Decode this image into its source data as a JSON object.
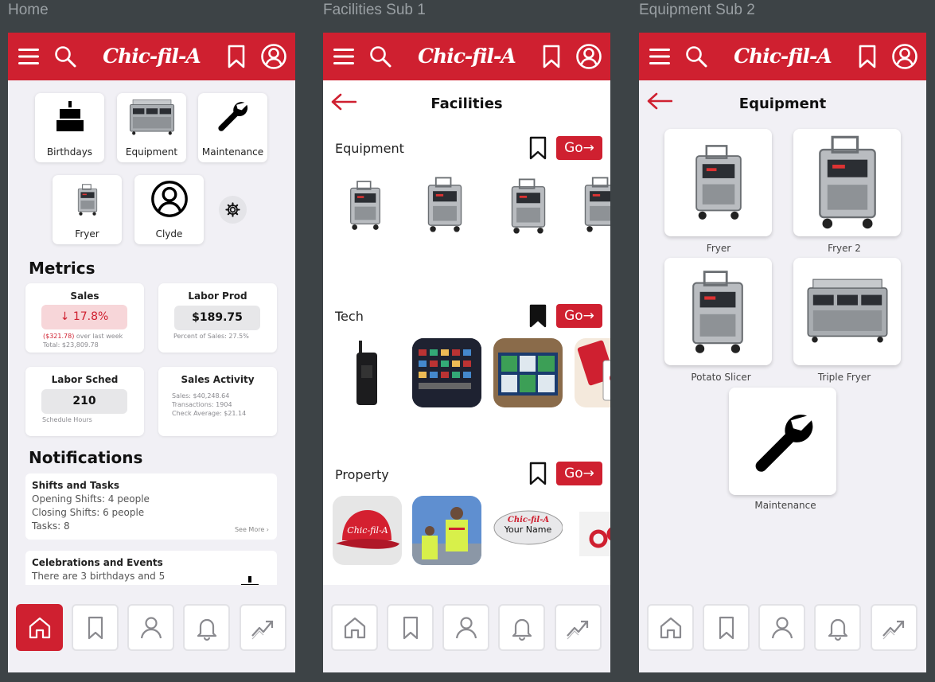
{
  "frames": {
    "home": "Home",
    "facilities": "Facilities Sub 1",
    "equipment": "Equipment Sub 2"
  },
  "brand": {
    "logo_text": "Chic-fil-A",
    "red": "#cf2030"
  },
  "icons": {
    "menu": "menu-icon",
    "search": "search-icon",
    "bookmark": "bookmark-icon",
    "profile": "profile-icon",
    "home": "home-icon",
    "bell": "bell-icon",
    "trend": "trending-icon",
    "gear": "gear-icon",
    "wrench": "wrench-icon",
    "cake": "cake-icon",
    "back": "back-arrow-icon"
  },
  "home": {
    "tiles": [
      "Birthdays",
      "Equipment",
      "Maintenance",
      "Fryer",
      "Clyde"
    ],
    "metrics_title": "Metrics",
    "sales": {
      "title": "Sales",
      "value": "17.8%",
      "change": "($321.78)",
      "change_suffix": " over last week",
      "total": "Total: $23,809.78"
    },
    "labor_prod": {
      "title": "Labor Prod",
      "value": "$189.75",
      "sub": "Percent of Sales: 27.5%"
    },
    "labor_sched": {
      "title": "Labor Sched",
      "value": "210",
      "sub": "Schedule Hours"
    },
    "sales_activity": {
      "title": "Sales Activity",
      "lines": [
        "Sales: $40,248.64",
        "Transactions: 1904",
        "Check Average: $21.14"
      ]
    },
    "notifications_title": "Notifications",
    "shifts": {
      "title": "Shifts and Tasks",
      "lines": [
        "Opening Shifts: 4 people",
        "Closing Shifts: 6 people",
        "Tasks: 8"
      ],
      "see_more": "See More ›"
    },
    "celebrations": {
      "title": "Celebrations and Events",
      "line": "There are 3 birthdays and 5"
    }
  },
  "facilities": {
    "title": "Facilities",
    "rows": [
      {
        "label": "Equipment",
        "go": "Go→",
        "bookmarked": false
      },
      {
        "label": "Tech",
        "go": "Go→",
        "bookmarked": true
      },
      {
        "label": "Property",
        "go": "Go→",
        "bookmarked": false
      }
    ],
    "name_tag": "Your Name"
  },
  "equipment": {
    "title": "Equipment",
    "items": [
      "Fryer",
      "Fryer 2",
      "Potato Slicer",
      "Triple Fryer",
      "Maintenance"
    ]
  }
}
